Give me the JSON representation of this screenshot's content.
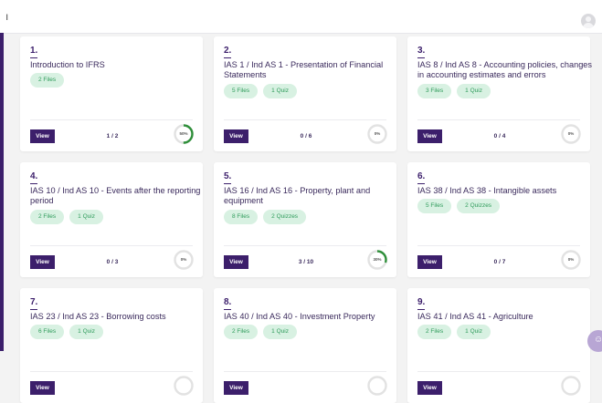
{
  "topbar": {
    "mark": "ı"
  },
  "colors": {
    "accent": "#3c1f6b",
    "chip_bg": "#d8f1e2",
    "chip_text": "#2e9b5a",
    "progress": "#2f8f3a",
    "ring_track": "#e2e2e2"
  },
  "view_label": "View",
  "cards": [
    {
      "num": "1.",
      "title": "Introduction to IFRS",
      "chips": [
        "2 Files"
      ],
      "count": "1 / 2",
      "progress_label": "50%",
      "progress": 0.5
    },
    {
      "num": "2.",
      "title": "IAS 1 / Ind AS 1 - Presentation of Financial Statements",
      "chips": [
        "5 Files",
        "1 Quiz"
      ],
      "count": "0 / 6",
      "progress_label": "0%",
      "progress": 0
    },
    {
      "num": "3.",
      "title": "IAS 8 / Ind AS 8 - Accounting policies, changes in accounting estimates and errors",
      "chips": [
        "3 Files",
        "1 Quiz"
      ],
      "count": "0 / 4",
      "progress_label": "0%",
      "progress": 0
    },
    {
      "num": "4.",
      "title": "IAS 10 / Ind AS 10 - Events after the reporting period",
      "chips": [
        "2 Files",
        "1 Quiz"
      ],
      "count": "0 / 3",
      "progress_label": "0%",
      "progress": 0
    },
    {
      "num": "5.",
      "title": "IAS 16 / Ind AS 16 - Property, plant and equipment",
      "chips": [
        "8 Files",
        "2 Quizzes"
      ],
      "count": "3 / 10",
      "progress_label": "30%",
      "progress": 0.3
    },
    {
      "num": "6.",
      "title": "IAS 38 / Ind AS 38 - Intangible assets",
      "chips": [
        "5 Files",
        "2 Quizzes"
      ],
      "count": "0 / 7",
      "progress_label": "0%",
      "progress": 0
    },
    {
      "num": "7.",
      "title": "IAS 23 / Ind AS 23 - Borrowing costs",
      "chips": [
        "6 Files",
        "1 Quiz"
      ],
      "count": "",
      "progress_label": "",
      "progress": 0
    },
    {
      "num": "8.",
      "title": "IAS 40 / Ind AS 40 - Investment Property",
      "chips": [
        "2 Files",
        "1 Quiz"
      ],
      "count": "",
      "progress_label": "",
      "progress": 0
    },
    {
      "num": "9.",
      "title": "IAS 41 / Ind AS 41 - Agriculture",
      "chips": [
        "2 Files",
        "1 Quiz"
      ],
      "count": "",
      "progress_label": "",
      "progress": 0
    }
  ]
}
